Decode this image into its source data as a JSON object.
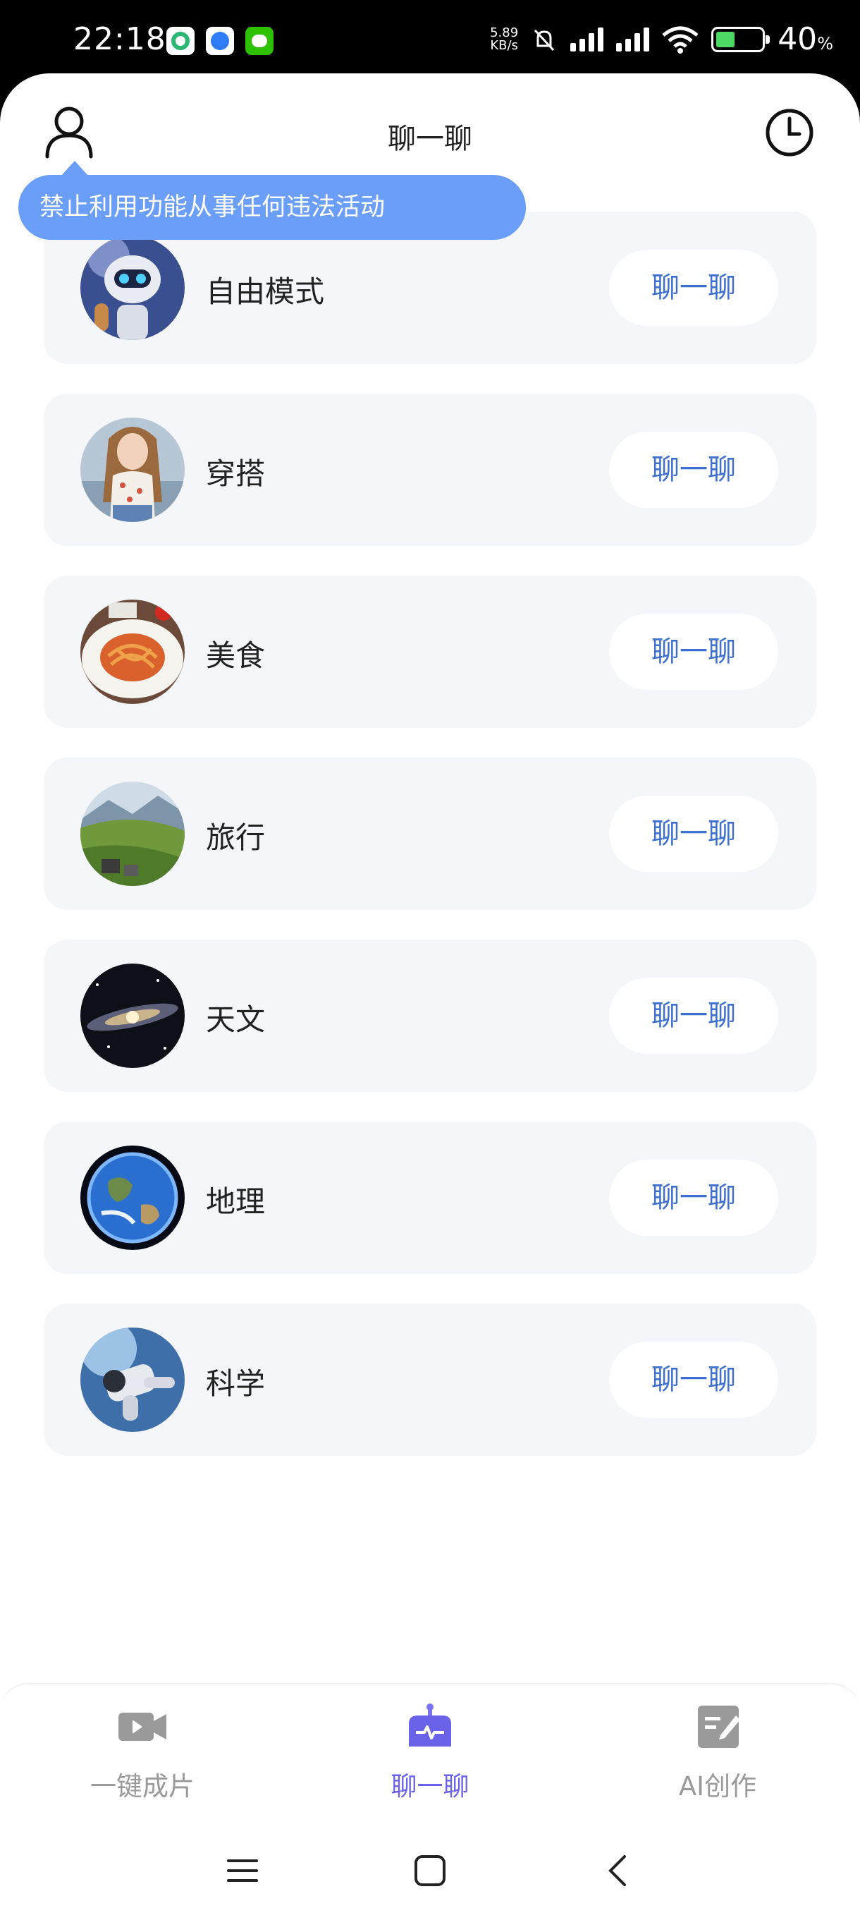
{
  "status": {
    "time": "22:18",
    "netspeed_value": "5.89",
    "netspeed_unit": "KB/s",
    "battery": "40",
    "battery_unit": "%"
  },
  "header": {
    "title": "聊一聊"
  },
  "tooltip": {
    "text": "禁止利用功能从事任何违法活动"
  },
  "items": [
    {
      "label": "自由模式",
      "button": "聊一聊",
      "image": "robot"
    },
    {
      "label": "穿搭",
      "button": "聊一聊",
      "image": "fashion-girl"
    },
    {
      "label": "美食",
      "button": "聊一聊",
      "image": "spaghetti"
    },
    {
      "label": "旅行",
      "button": "聊一聊",
      "image": "valley"
    },
    {
      "label": "天文",
      "button": "聊一聊",
      "image": "galaxy"
    },
    {
      "label": "地理",
      "button": "聊一聊",
      "image": "earth"
    },
    {
      "label": "科学",
      "button": "聊一聊",
      "image": "astronaut"
    }
  ],
  "tabs": [
    {
      "label": "一键成片",
      "icon": "video-camera-icon"
    },
    {
      "label": "聊一聊",
      "icon": "robot-icon",
      "active": true
    },
    {
      "label": "AI创作",
      "icon": "note-edit-icon"
    }
  ],
  "colors": {
    "accent": "#3d6fd0",
    "tab_active": "#6a62e8",
    "tooltip_bg": "#6a9ef9",
    "card_bg": "#f4f6f9"
  }
}
